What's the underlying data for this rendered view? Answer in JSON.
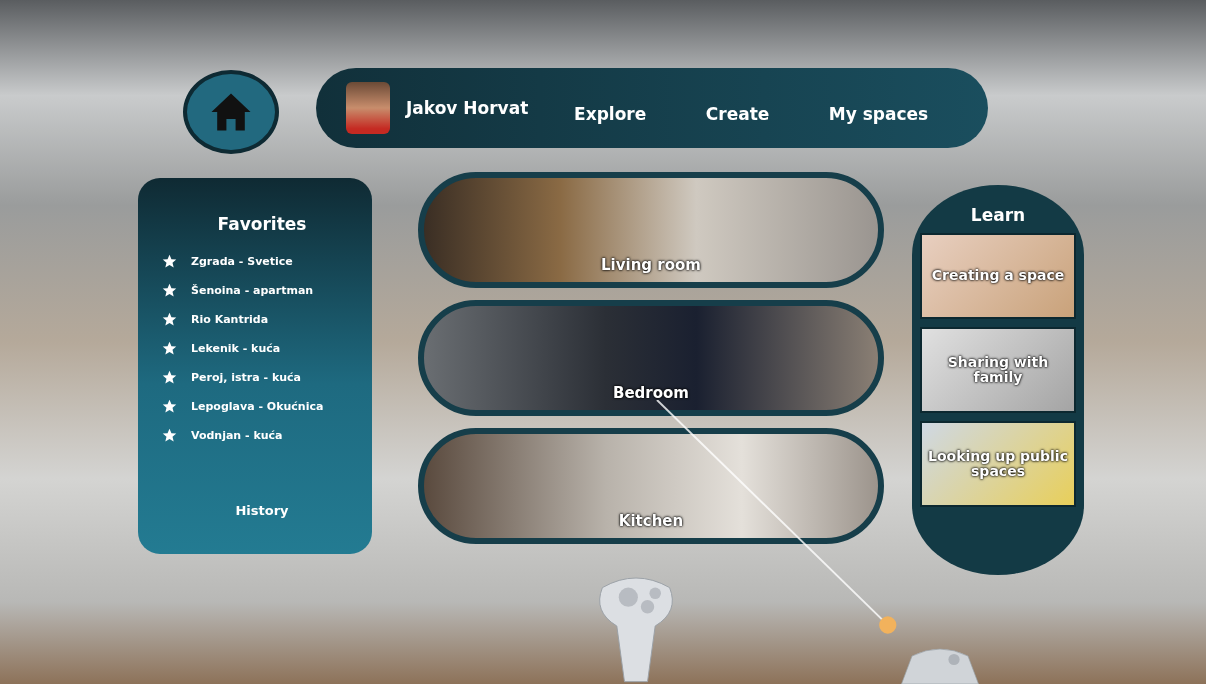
{
  "user": {
    "name": "Jakov Horvat"
  },
  "nav": [
    {
      "label": "Explore"
    },
    {
      "label": "Create"
    },
    {
      "label": "My spaces"
    }
  ],
  "favorites": {
    "title": "Favorites",
    "items": [
      "Zgrada - Svetice",
      "Šenoina - apartman",
      "Rio Kantrida",
      "Lekenik - kuća",
      "Peroj, istra - kuća",
      "Lepoglava - Okućnica",
      "Vodnjan - kuća"
    ],
    "footer": "History"
  },
  "spaces": [
    {
      "label": "Living room"
    },
    {
      "label": "Bedroom"
    },
    {
      "label": "Kitchen"
    }
  ],
  "learn": {
    "title": "Learn",
    "items": [
      "Creating a space",
      "Sharing with family",
      "Looking up public spaces"
    ]
  }
}
